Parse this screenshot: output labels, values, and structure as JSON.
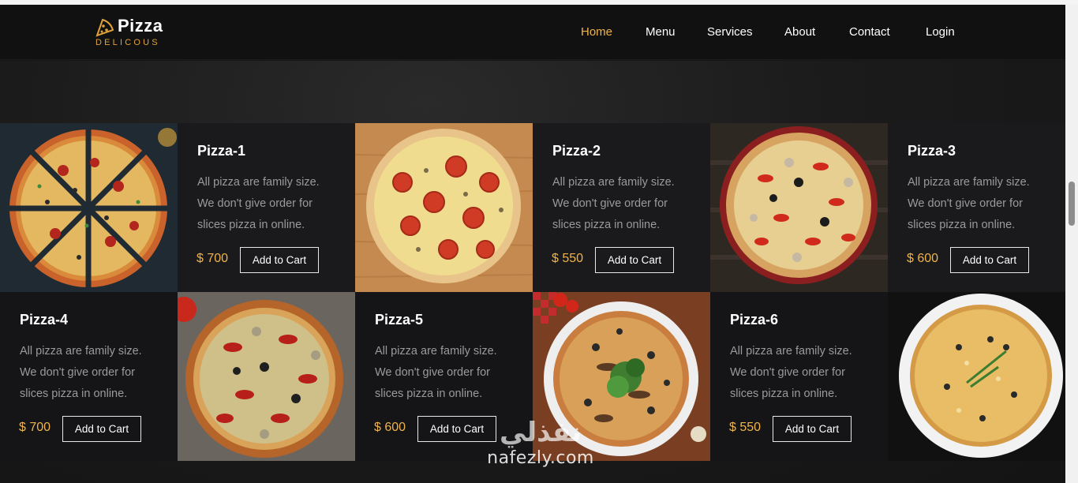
{
  "brand": {
    "name": "Pizza",
    "tagline": "DELICOUS",
    "accent_color": "#f0b44a",
    "icon": "pizza-slice-icon"
  },
  "nav": {
    "items": [
      {
        "label": "Home",
        "active": true
      },
      {
        "label": "Menu",
        "active": false
      },
      {
        "label": "Services",
        "active": false
      },
      {
        "label": "About",
        "active": false
      },
      {
        "label": "Contact",
        "active": false
      },
      {
        "label": "Login",
        "active": false
      }
    ]
  },
  "products": [
    {
      "name": "Pizza-1",
      "description": "All pizza are family size. We don't give order for slices pizza in online.",
      "price": "$ 700",
      "button": "Add to Cart"
    },
    {
      "name": "Pizza-2",
      "description": "All pizza are family size. We don't give order for slices pizza in online.",
      "price": "$ 550",
      "button": "Add to Cart"
    },
    {
      "name": "Pizza-3",
      "description": "All pizza are family size. We don't give order for slices pizza in online.",
      "price": "$ 600",
      "button": "Add to Cart"
    },
    {
      "name": "Pizza-4",
      "description": "All pizza are family size. We don't give order for slices pizza in online.",
      "price": "$ 700",
      "button": "Add to Cart"
    },
    {
      "name": "Pizza-5",
      "description": "All pizza are family size. We don't give order for slices pizza in online.",
      "price": "$ 600",
      "button": "Add to Cart"
    },
    {
      "name": "Pizza-6",
      "description": "All pizza are family size. We don't give order for slices pizza in online.",
      "price": "$ 550",
      "button": "Add to Cart"
    }
  ],
  "watermark": {
    "arabic": "نفذلي",
    "latin": "nafezly.com"
  }
}
